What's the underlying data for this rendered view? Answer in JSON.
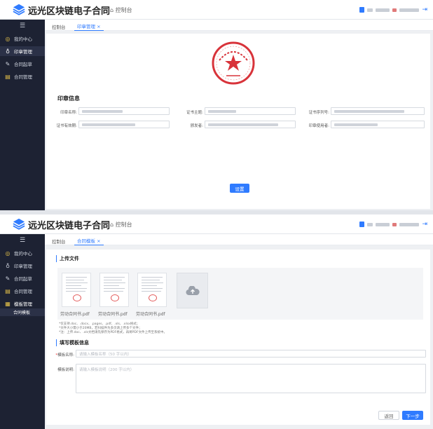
{
  "app": {
    "title": "远光区块链电子合同",
    "home_label": "⌂ 控制台"
  },
  "header_right": {
    "user_name": "▆▆▆ ▆▆▆▆▆▆▆▆",
    "org_name": "▆▆▆▆▆▆▆▆"
  },
  "sidebar": {
    "menu_icon": "☰",
    "items": [
      {
        "label": "我的中心",
        "icon": "user-circle-icon"
      },
      {
        "label": "印章管理",
        "icon": "seal-icon"
      },
      {
        "label": "合同起草",
        "icon": "edit-icon"
      },
      {
        "label": "合同管理",
        "icon": "document-icon"
      }
    ],
    "template_menu": {
      "label": "模板管理",
      "sub": "合同模板"
    }
  },
  "screen1": {
    "tabs": [
      "控制台",
      "印章管理 ×"
    ],
    "section": "印章信息",
    "fields": [
      {
        "label": "印章名称:",
        "value": "▇▇▇▇▇▇▇▇▇"
      },
      {
        "label": "证书主题:",
        "value": "▇▇▇▇▇▇"
      },
      {
        "label": "证书序列号:",
        "value": "▇▇▇▇▇▇▇▇▇▇▇▇▇▇▇▇"
      },
      {
        "label": "证书有效期:",
        "value": "▇▇▇▇▇▇▇▇▇▇▇▇"
      },
      {
        "label": "颁发者:",
        "value": "▇▇▇▇▇▇▇▇▇▇▇▇▇▇▇▇"
      },
      {
        "label": "印章使用者:",
        "value": "▇▇▇ ▇▇▇ ▇▇▇ ▇▇▇ ..."
      }
    ],
    "button": "设置"
  },
  "screen2": {
    "tabs": [
      "控制台",
      "合同模板 ×"
    ],
    "upload_title": "上传文件",
    "files": [
      "劳动合同书.pdf",
      "劳动合同书.pdf",
      "劳动合同书.pdf"
    ],
    "hints": [
      "*仅支持.doc、.docx、.pages、.pdf、.xls、.xlsx格式；",
      "*文件大小需小于20MB，若扫描件为多页请上传多个文件；",
      "*注：上传.doc、.xls文档请先保存为PDF格式，再将PDF文件上传至系统中。"
    ],
    "fill_title": "填写模板信息",
    "name_label": "模板名称:",
    "name_placeholder": "请输入模板名称（50 字以内）",
    "desc_label": "模板说明:",
    "desc_placeholder": "请输入模板说明（200 字以内）",
    "back_button": "返回",
    "next_button": "下一步"
  },
  "colors": {
    "primary": "#2f7bff",
    "sidebar": "#1d2233",
    "seal": "#d8333a"
  }
}
